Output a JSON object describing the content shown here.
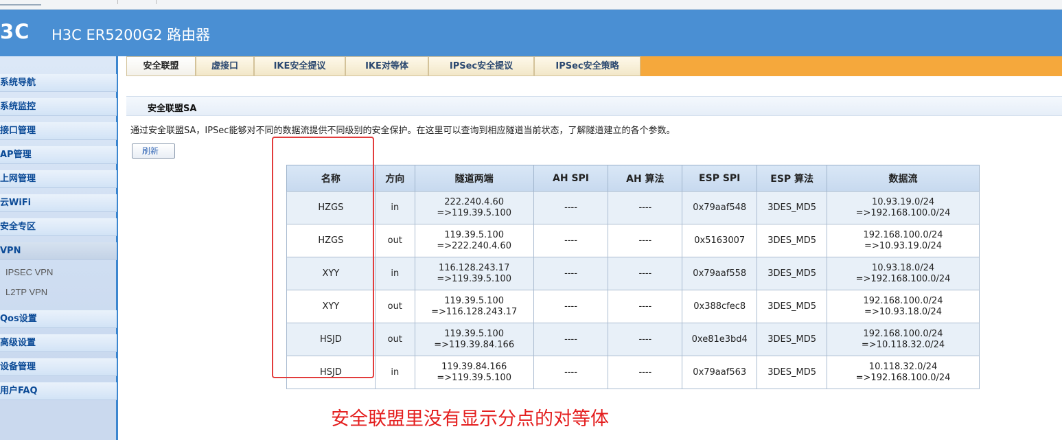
{
  "header": {
    "brand": "3C",
    "product": "H3C ER5200G2 路由器"
  },
  "sidebar": {
    "items": [
      {
        "label": "系统导航"
      },
      {
        "label": "系统监控"
      },
      {
        "label": "接口管理"
      },
      {
        "label": "AP管理"
      },
      {
        "label": "上网管理"
      },
      {
        "label": "云WiFi"
      },
      {
        "label": "安全专区"
      },
      {
        "label": "VPN"
      },
      {
        "label": "Qos设置"
      },
      {
        "label": "高级设置"
      },
      {
        "label": "设备管理"
      },
      {
        "label": "用户FAQ"
      }
    ],
    "vpn_subitems": [
      {
        "label": "IPSEC VPN"
      },
      {
        "label": "L2TP VPN"
      }
    ]
  },
  "tabs": [
    {
      "label": "安全联盟",
      "active": true
    },
    {
      "label": "虚接口"
    },
    {
      "label": "IKE安全提议"
    },
    {
      "label": "IKE对等体"
    },
    {
      "label": "IPSec安全提议"
    },
    {
      "label": "IPSec安全策略"
    }
  ],
  "section": {
    "title": "安全联盟SA",
    "description": "通过安全联盟SA，IPSec能够对不同的数据流提供不同级别的安全保护。在这里可以查询到相应隧道当前状态，了解隧道建立的各个参数。",
    "refresh_label": "刷新"
  },
  "table": {
    "headers": [
      "名称",
      "方向",
      "隧道两端",
      "AH SPI",
      "AH 算法",
      "ESP SPI",
      "ESP 算法",
      "数据流"
    ],
    "rows": [
      {
        "name": "HZGS",
        "direction": "in",
        "tunnel_1": "222.240.4.60",
        "tunnel_2": "=>119.39.5.100",
        "ah_spi": "----",
        "ah_alg": "----",
        "esp_spi": "0x79aaf548",
        "esp_alg": "3DES_MD5",
        "flow_1": "10.93.19.0/24",
        "flow_2": "=>192.168.100.0/24"
      },
      {
        "name": "HZGS",
        "direction": "out",
        "tunnel_1": "119.39.5.100",
        "tunnel_2": "=>222.240.4.60",
        "ah_spi": "----",
        "ah_alg": "----",
        "esp_spi": "0x5163007",
        "esp_alg": "3DES_MD5",
        "flow_1": "192.168.100.0/24",
        "flow_2": "=>10.93.19.0/24"
      },
      {
        "name": "XYY",
        "direction": "in",
        "tunnel_1": "116.128.243.17",
        "tunnel_2": "=>119.39.5.100",
        "ah_spi": "----",
        "ah_alg": "----",
        "esp_spi": "0x79aaf558",
        "esp_alg": "3DES_MD5",
        "flow_1": "10.93.18.0/24",
        "flow_2": "=>192.168.100.0/24"
      },
      {
        "name": "XYY",
        "direction": "out",
        "tunnel_1": "119.39.5.100",
        "tunnel_2": "=>116.128.243.17",
        "ah_spi": "----",
        "ah_alg": "----",
        "esp_spi": "0x388cfec8",
        "esp_alg": "3DES_MD5",
        "flow_1": "192.168.100.0/24",
        "flow_2": "=>10.93.18.0/24"
      },
      {
        "name": "HSJD",
        "direction": "out",
        "tunnel_1": "119.39.5.100",
        "tunnel_2": "=>119.39.84.166",
        "ah_spi": "----",
        "ah_alg": "----",
        "esp_spi": "0xe81e3bd4",
        "esp_alg": "3DES_MD5",
        "flow_1": "192.168.100.0/24",
        "flow_2": "=>10.118.32.0/24"
      },
      {
        "name": "HSJD",
        "direction": "in",
        "tunnel_1": "119.39.84.166",
        "tunnel_2": "=>119.39.5.100",
        "ah_spi": "----",
        "ah_alg": "----",
        "esp_spi": "0x79aaf563",
        "esp_alg": "3DES_MD5",
        "flow_1": "10.118.32.0/24",
        "flow_2": "=>192.168.100.0/24"
      }
    ]
  },
  "annotation": {
    "text": "安全联盟里没有显示分点的对等体",
    "color": "#e41f1f"
  },
  "colors": {
    "header_blue": "#4a8fd3",
    "tab_orange": "#f5a83c",
    "sidebar_blue": "#3c86cf"
  }
}
